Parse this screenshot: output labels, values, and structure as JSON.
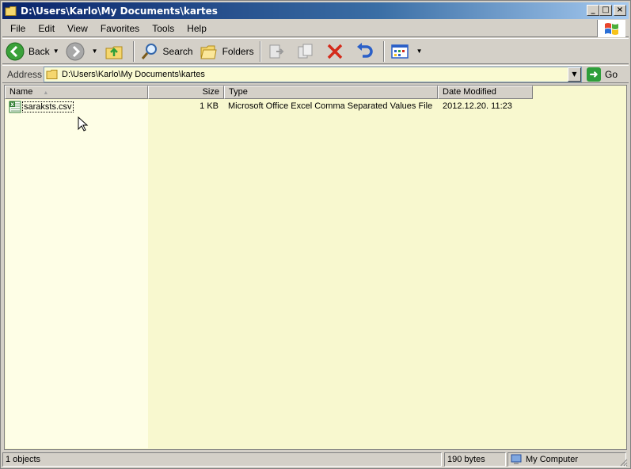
{
  "window": {
    "title": "D:\\Users\\Karlo\\My Documents\\kartes"
  },
  "titlebar_buttons": {
    "minimize": "_",
    "maximize": "□",
    "close": "×"
  },
  "menu": {
    "items": [
      "File",
      "Edit",
      "View",
      "Favorites",
      "Tools",
      "Help"
    ]
  },
  "toolbar": {
    "back_label": "Back",
    "search_label": "Search",
    "folders_label": "Folders",
    "icons": [
      "back-icon",
      "forward-icon",
      "up-folder-icon",
      "search-icon",
      "folders-icon",
      "move-to-icon",
      "copy-to-icon",
      "delete-icon",
      "undo-icon",
      "views-icon"
    ]
  },
  "address": {
    "label": "Address",
    "value": "D:\\Users\\Karlo\\My Documents\\kartes",
    "go_label": "Go"
  },
  "columns": [
    {
      "key": "name",
      "label": "Name"
    },
    {
      "key": "size",
      "label": "Size"
    },
    {
      "key": "type",
      "label": "Type"
    },
    {
      "key": "date",
      "label": "Date Modified"
    }
  ],
  "files": [
    {
      "name": "saraksts.csv",
      "size": "1 KB",
      "type": "Microsoft Office Excel Comma Separated Values File",
      "date": "2012.12.20.  11:23",
      "icon": "excel-csv-icon"
    }
  ],
  "status": {
    "objects": "1 objects",
    "size": "190 bytes",
    "zone": "My Computer"
  },
  "colors": {
    "title_gradient_start": "#0a246a",
    "title_gradient_end": "#a6caf0",
    "list_background": "#f8f8cf",
    "chrome": "#d4d0c8"
  }
}
